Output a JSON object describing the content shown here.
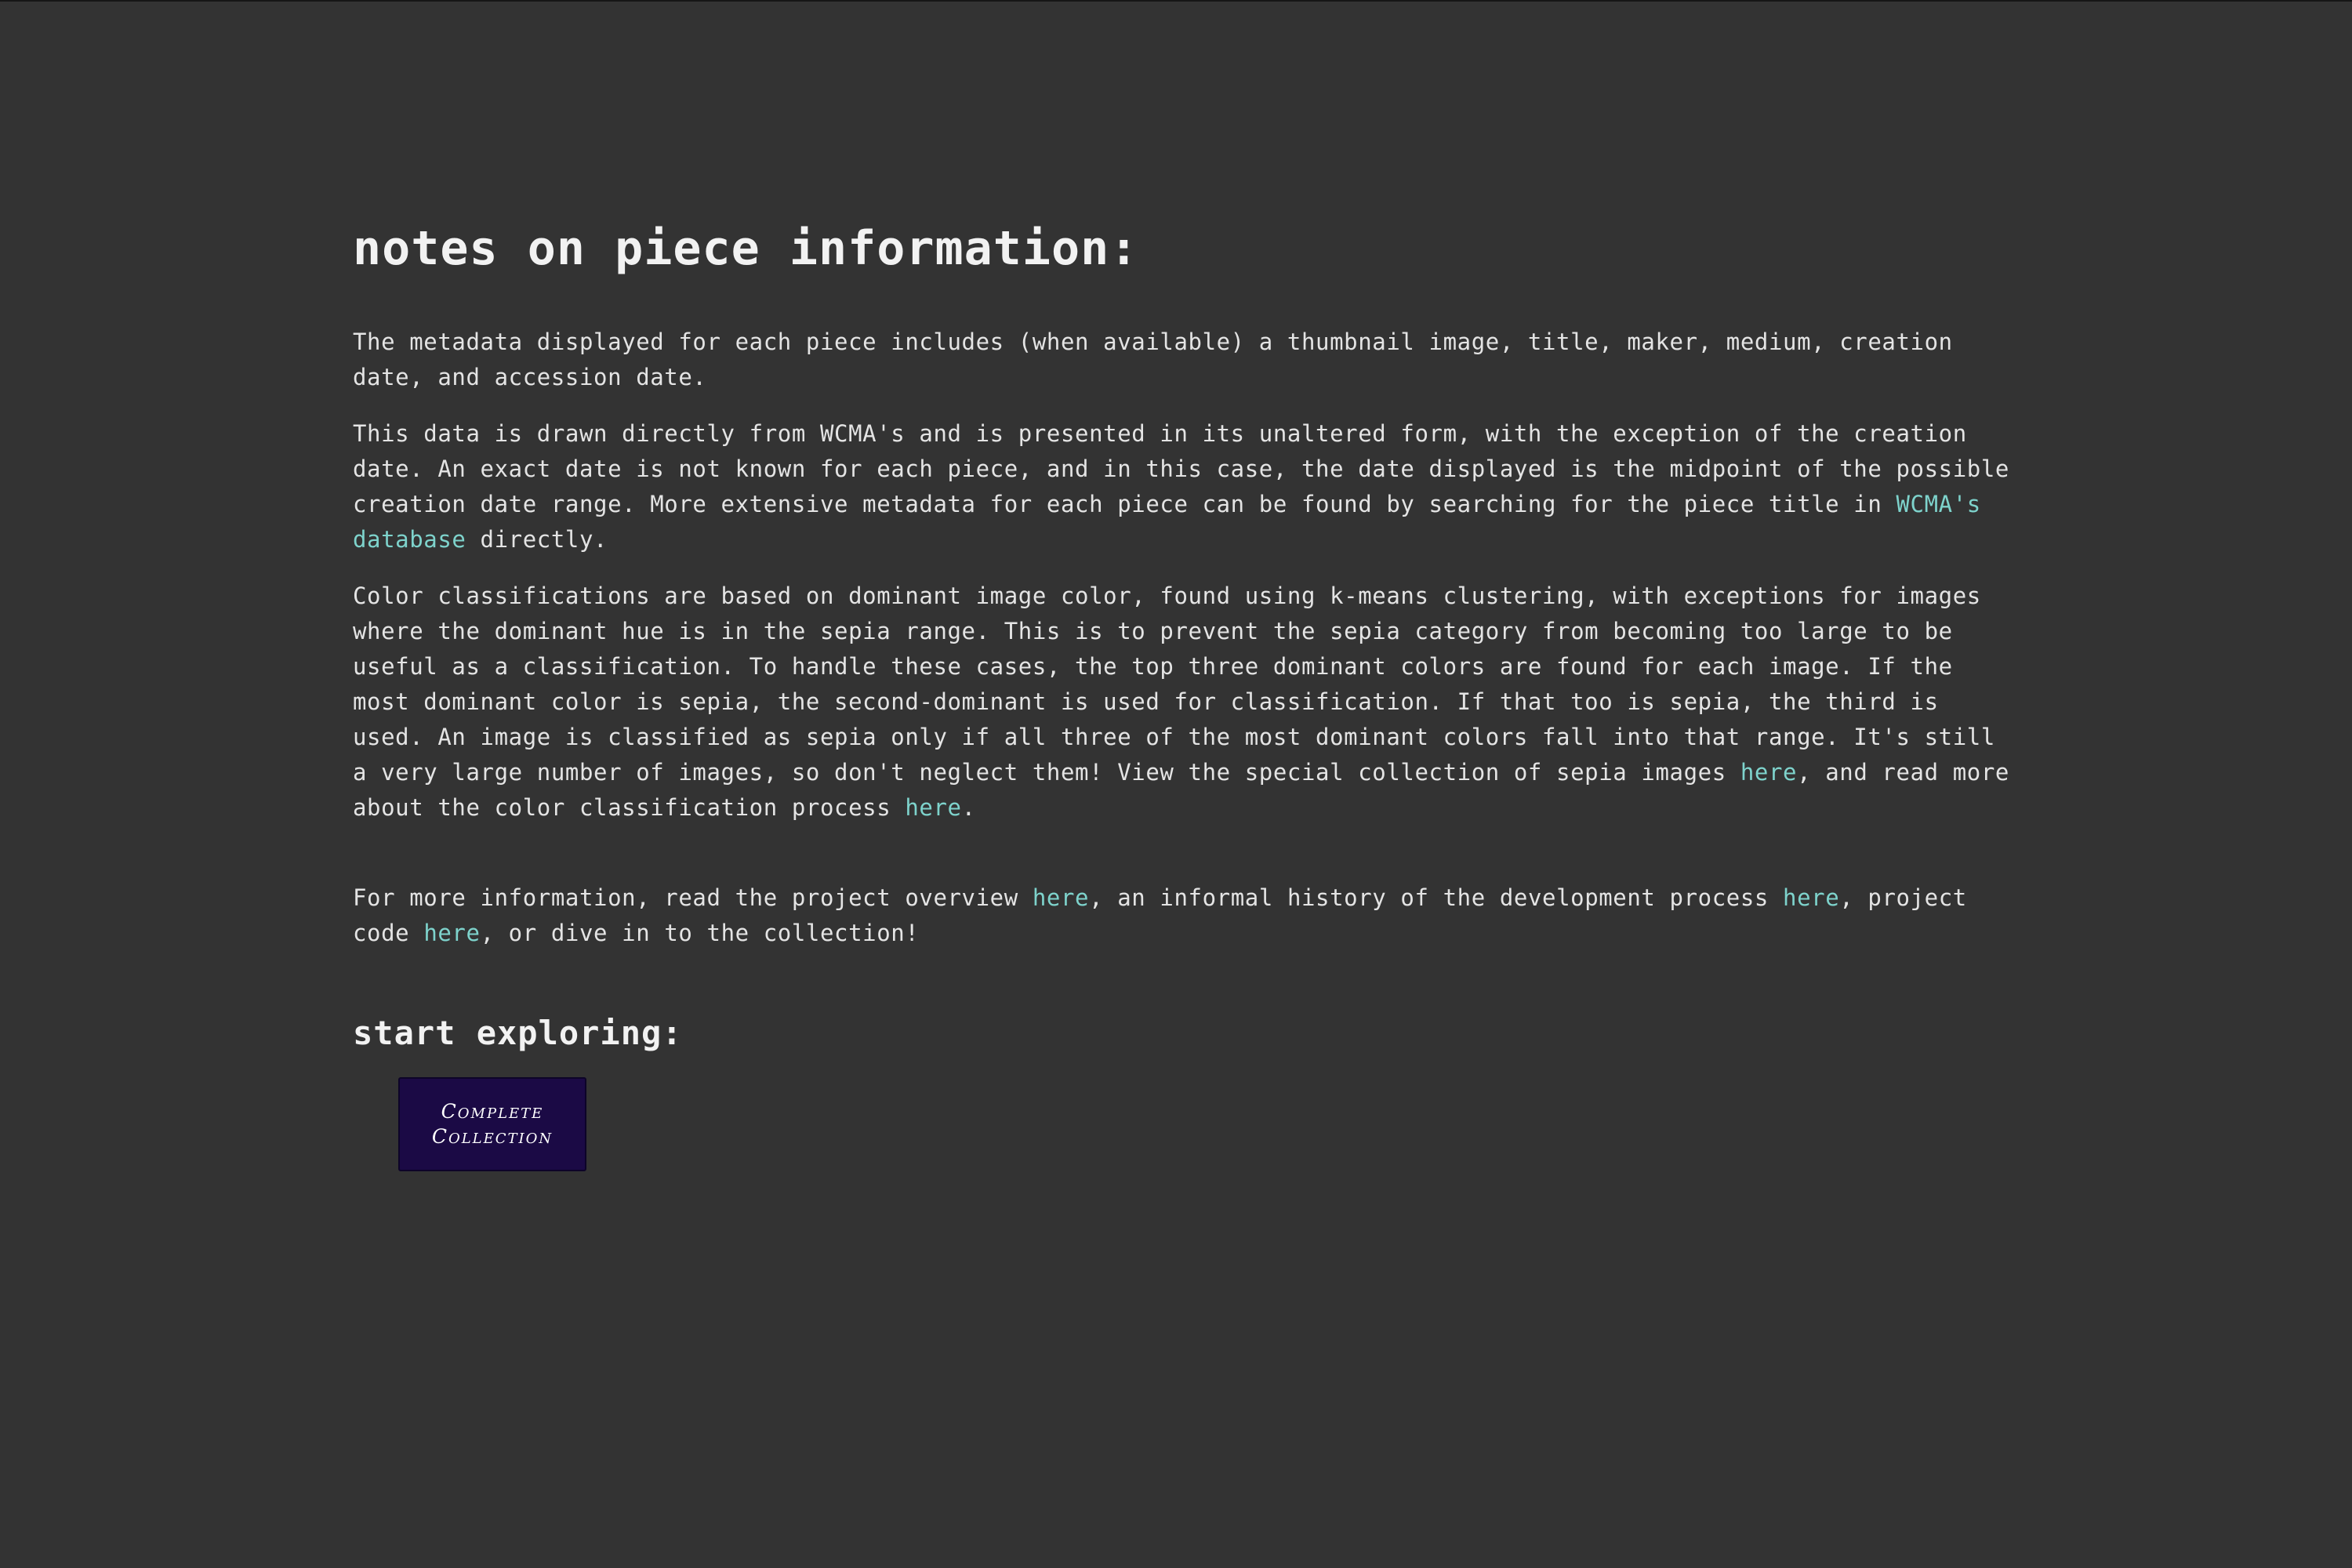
{
  "heading": "notes on piece information:",
  "paragraphs": {
    "p1": "The metadata displayed for each piece includes (when available) a thumbnail image, title, maker, medium, creation date, and accession date.",
    "p2_before": "This data is drawn directly from WCMA's and is presented in its unaltered form, with the exception of the creation date. An exact date is not known for each piece, and in this case, the date displayed is the midpoint of the possible creation date range. More extensive metadata for each piece can be found by searching for the piece title in ",
    "p2_link": "WCMA's database",
    "p2_after": " directly.",
    "p3_before": "Color classifications are based on dominant image color, found using k-means clustering, with exceptions for images where the dominant hue is in the sepia range. This is to prevent the sepia category from becoming too large to be useful as a classification. To handle these cases, the top three dominant colors are found for each image. If the most dominant color is sepia, the second-dominant is used for classification. If that too is sepia, the third is used. An image is classified as sepia only if all three of the most dominant colors fall into that range. It's still a very large number of images, so don't neglect them! View the special collection of sepia images ",
    "p3_link1": "here",
    "p3_mid": ", and read more about the color classification process ",
    "p3_link2": "here",
    "p3_after": ".",
    "p4_before": "For more information, read the project overview ",
    "p4_link1": "here",
    "p4_mid1": ", an informal history of the development process ",
    "p4_link2": "here",
    "p4_mid2": ", project code ",
    "p4_link3": "here",
    "p4_after": ", or dive in to the collection!"
  },
  "subheading": "start exploring:",
  "collection_button": {
    "label": "Complete Collection"
  },
  "colors": {
    "background": "#333333",
    "link": "#7ed3cc",
    "button_bg": "#1b0a45"
  }
}
